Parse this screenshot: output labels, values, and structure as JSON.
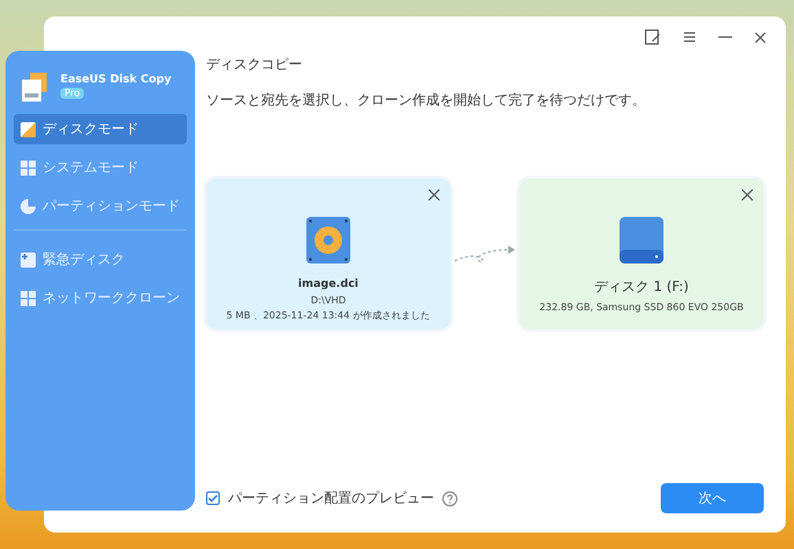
{
  "app": {
    "name": "EaseUS Disk Copy",
    "badge": "Pro"
  },
  "sidebar": {
    "groups": [
      {
        "items": [
          {
            "label": "ディスクモード",
            "kind": "disk",
            "selected": true
          },
          {
            "label": "システムモード",
            "kind": "windows",
            "selected": false
          },
          {
            "label": "パーティションモード",
            "kind": "pie",
            "selected": false
          }
        ]
      },
      {
        "items": [
          {
            "label": "緊急ディスク",
            "kind": "plus",
            "selected": false
          },
          {
            "label": "ネットワーククローン",
            "kind": "windows",
            "selected": false
          }
        ]
      }
    ]
  },
  "page": {
    "title": "ディスクコピー",
    "description": "ソースと宛先を選択し、クローン作成を開始して完了を待つだけです。"
  },
  "source": {
    "name": "image.dci",
    "path": "D:\\VHD",
    "details": "5 MB 、2025-11-24 13:44 が作成されました"
  },
  "target": {
    "name": "ディスク 1 (F:)",
    "details": "232.89 GB, Samsung SSD 860 EVO 250GB"
  },
  "footer": {
    "preview_label": "パーティション配置のプレビュー",
    "preview_checked": true,
    "next_button": "次へ"
  }
}
